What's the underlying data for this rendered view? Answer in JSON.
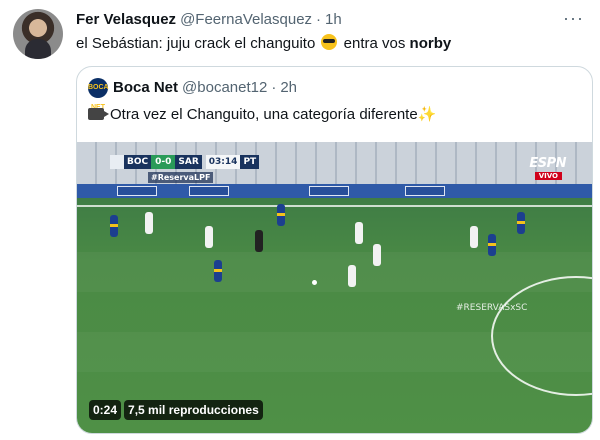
{
  "tweet": {
    "author_name": "Fer Velasquez",
    "author_handle": "@FeernaVelasquez",
    "separator": "·",
    "time": "1h",
    "text_before_emoji": "el Sebástian: juju crack el changuito",
    "text_after_emoji": " entra vos ",
    "text_bold": "norby",
    "emoji": "sunglasses-emoji"
  },
  "quoted": {
    "author_name": "Boca Net",
    "author_handle": "@bocanet12",
    "separator": "·",
    "time": "2h",
    "avatar_label": "BOCA NET",
    "text": "Otra vez el Changuito, una categoría diferente",
    "leading_icon": "video-camera-icon",
    "trailing_icon": "sparkles-icon"
  },
  "video": {
    "scorebug": {
      "home": "BOC",
      "score": "0-0",
      "away": "SAR",
      "clock": "03:14",
      "period": "PT"
    },
    "hashtag": "#ReservaLPF",
    "broadcaster": "ESPN",
    "live_label": "VIVO",
    "watermark": "#RESERVASxSC",
    "duration": "0:24",
    "views": "7,5 mil reproducciones"
  },
  "colors": {
    "text": "#0f1419",
    "muted": "#536471",
    "border": "#cfd9de"
  }
}
